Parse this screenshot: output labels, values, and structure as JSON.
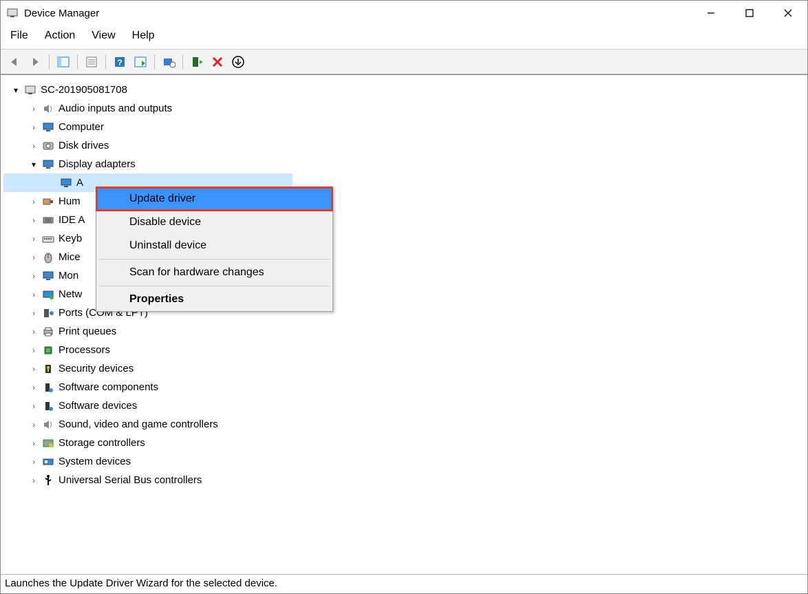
{
  "window": {
    "title": "Device Manager"
  },
  "menu": {
    "file": "File",
    "action": "Action",
    "view": "View",
    "help": "Help"
  },
  "tree": {
    "root": "SC-201905081708",
    "items": [
      {
        "label": "Audio inputs and outputs",
        "icon": "speaker"
      },
      {
        "label": "Computer",
        "icon": "monitor"
      },
      {
        "label": "Disk drives",
        "icon": "disk"
      },
      {
        "label": "Display adapters",
        "icon": "monitor",
        "expanded": true,
        "children": [
          {
            "label": "A",
            "icon": "monitor",
            "selected": true
          }
        ]
      },
      {
        "label": "Hum",
        "icon": "hid"
      },
      {
        "label": "IDE A",
        "icon": "ide"
      },
      {
        "label": "Keyb",
        "icon": "keyboard"
      },
      {
        "label": "Mice",
        "icon": "mouse"
      },
      {
        "label": "Mon",
        "icon": "monitor"
      },
      {
        "label": "Netw",
        "icon": "network"
      },
      {
        "label": "Ports (COM & LPT)",
        "icon": "port"
      },
      {
        "label": "Print queues",
        "icon": "printer"
      },
      {
        "label": "Processors",
        "icon": "cpu"
      },
      {
        "label": "Security devices",
        "icon": "security"
      },
      {
        "label": "Software components",
        "icon": "software"
      },
      {
        "label": "Software devices",
        "icon": "software"
      },
      {
        "label": "Sound, video and game controllers",
        "icon": "speaker"
      },
      {
        "label": "Storage controllers",
        "icon": "storage"
      },
      {
        "label": "System devices",
        "icon": "system"
      },
      {
        "label": "Universal Serial Bus controllers",
        "icon": "usb"
      }
    ]
  },
  "context": {
    "update": "Update driver",
    "disable": "Disable device",
    "uninstall": "Uninstall device",
    "scan": "Scan for hardware changes",
    "properties": "Properties"
  },
  "status": "Launches the Update Driver Wizard for the selected device."
}
